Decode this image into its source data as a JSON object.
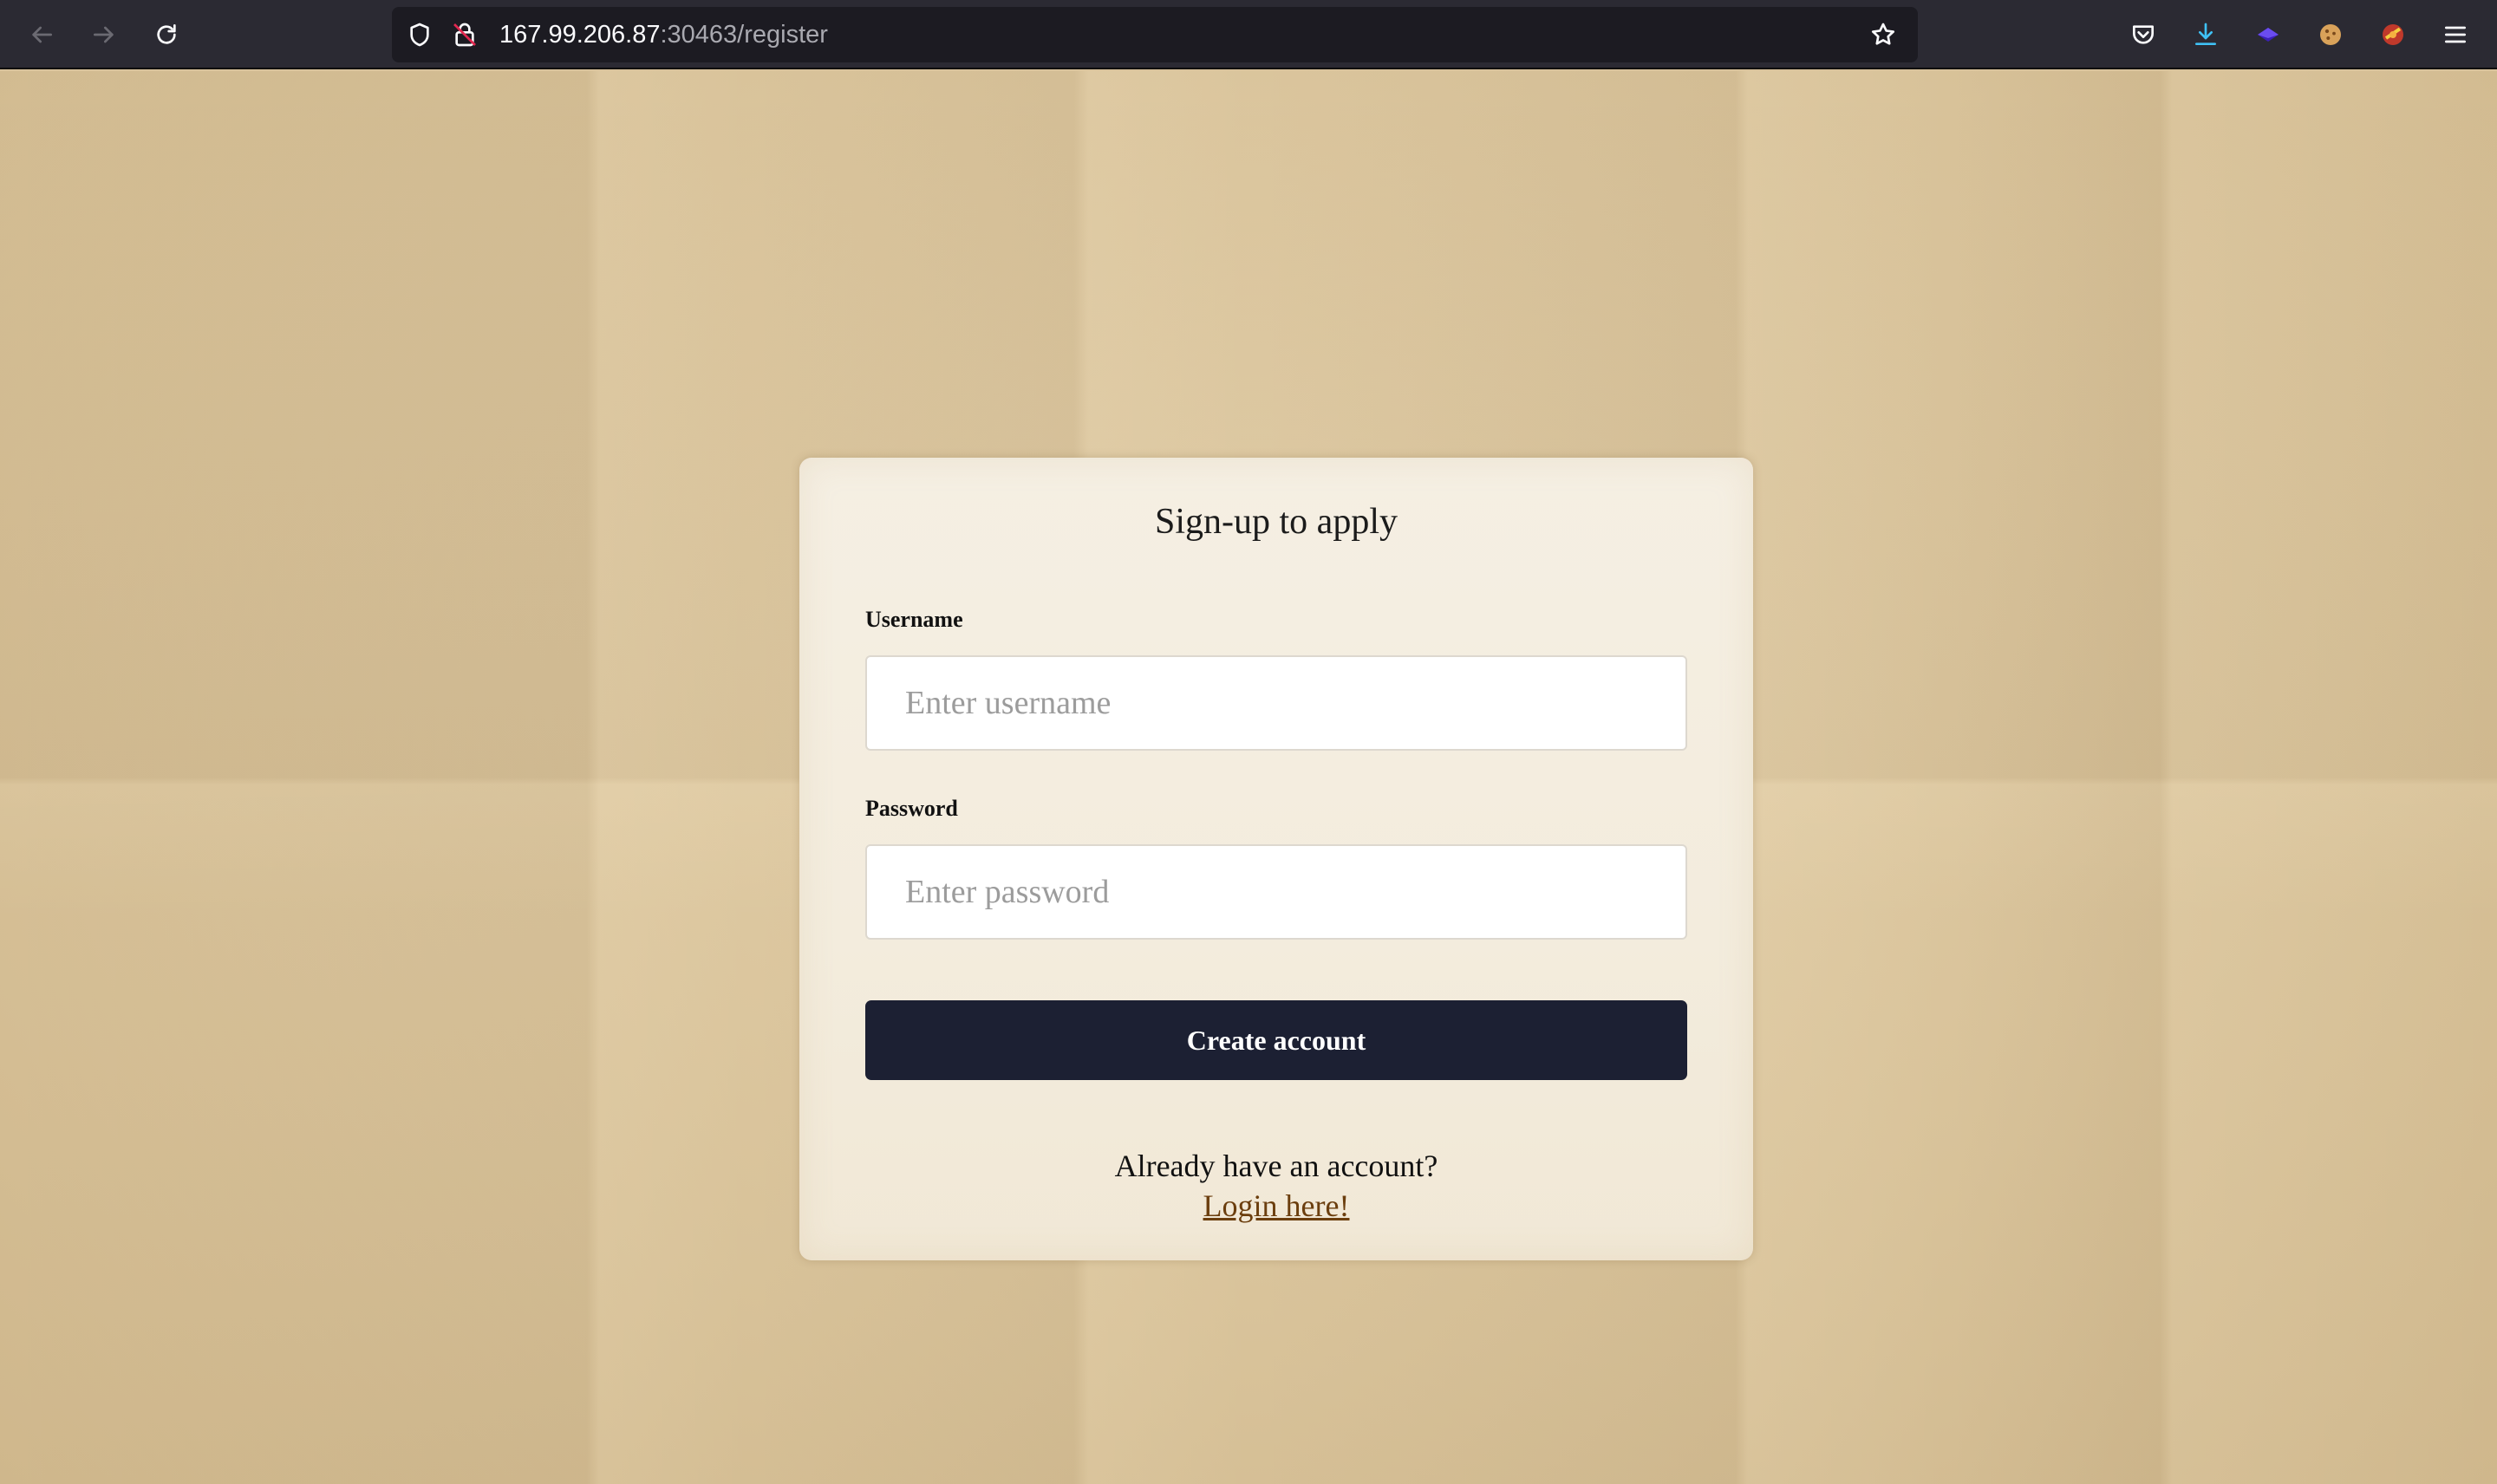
{
  "browser": {
    "url_host": "167.99.206.87",
    "url_rest": ":30463/register",
    "icons": [
      "back-icon",
      "forward-icon",
      "reload-icon",
      "shield-icon",
      "insecure-lock-icon",
      "bookmark-star-icon",
      "pocket-icon",
      "downloads-icon",
      "extension-icon",
      "cookie-extension-icon",
      "extension-icon",
      "hamburger-menu-icon"
    ],
    "colors": {
      "toolbar": "#2b2a33",
      "urlbar": "#1c1b22",
      "download_accent": "#3fc1f5"
    }
  },
  "form": {
    "title": "Sign-up to apply",
    "username_label": "Username",
    "username_placeholder": "Enter username",
    "username_value": "",
    "password_label": "Password",
    "password_placeholder": "Enter password",
    "password_value": "",
    "submit_label": "Create account",
    "already_text": "Already have an account?",
    "login_link": "Login here!",
    "colors": {
      "button": "#1c2033",
      "link": "#6b3e0e",
      "card": "#f5efe3"
    }
  }
}
